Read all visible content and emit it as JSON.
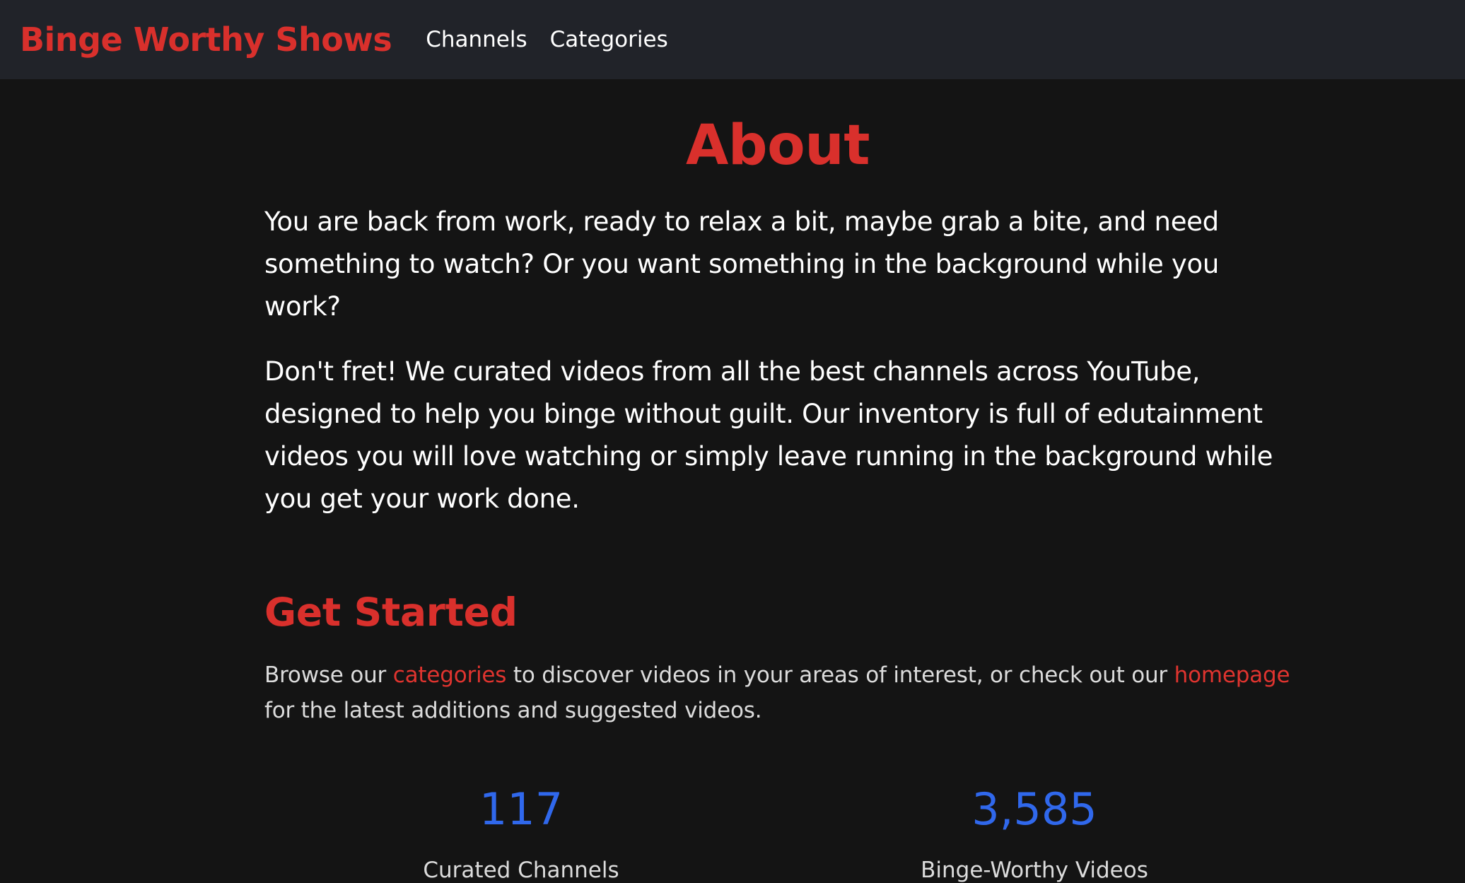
{
  "navbar": {
    "brand": "Binge Worthy Shows",
    "links": [
      {
        "label": "Channels"
      },
      {
        "label": "Categories"
      }
    ]
  },
  "about": {
    "title": "About",
    "paragraph1": "You are back from work, ready to relax a bit, maybe grab a bite, and need something to watch? Or you want something in the background while you work?",
    "paragraph2": "Don't fret! We curated videos from all the best channels across YouTube, designed to help you binge without guilt. Our inventory is full of edutainment videos you will love watching or simply leave running in the background while you get your work done."
  },
  "get_started": {
    "title": "Get Started",
    "text_before": "Browse our ",
    "categories_link": "categories",
    "text_middle": " to discover videos in your areas of interest, or check out our ",
    "homepage_link": "homepage",
    "text_after": " for the latest additions and suggested videos."
  },
  "stats": [
    {
      "number": "117",
      "label": "Curated Channels"
    },
    {
      "number": "3,585",
      "label": "Binge-Worthy Videos"
    }
  ],
  "colors": {
    "accent_red": "#d9302c",
    "stat_blue": "#3068ec",
    "navbar_bg": "#212329",
    "page_bg": "#141414"
  }
}
